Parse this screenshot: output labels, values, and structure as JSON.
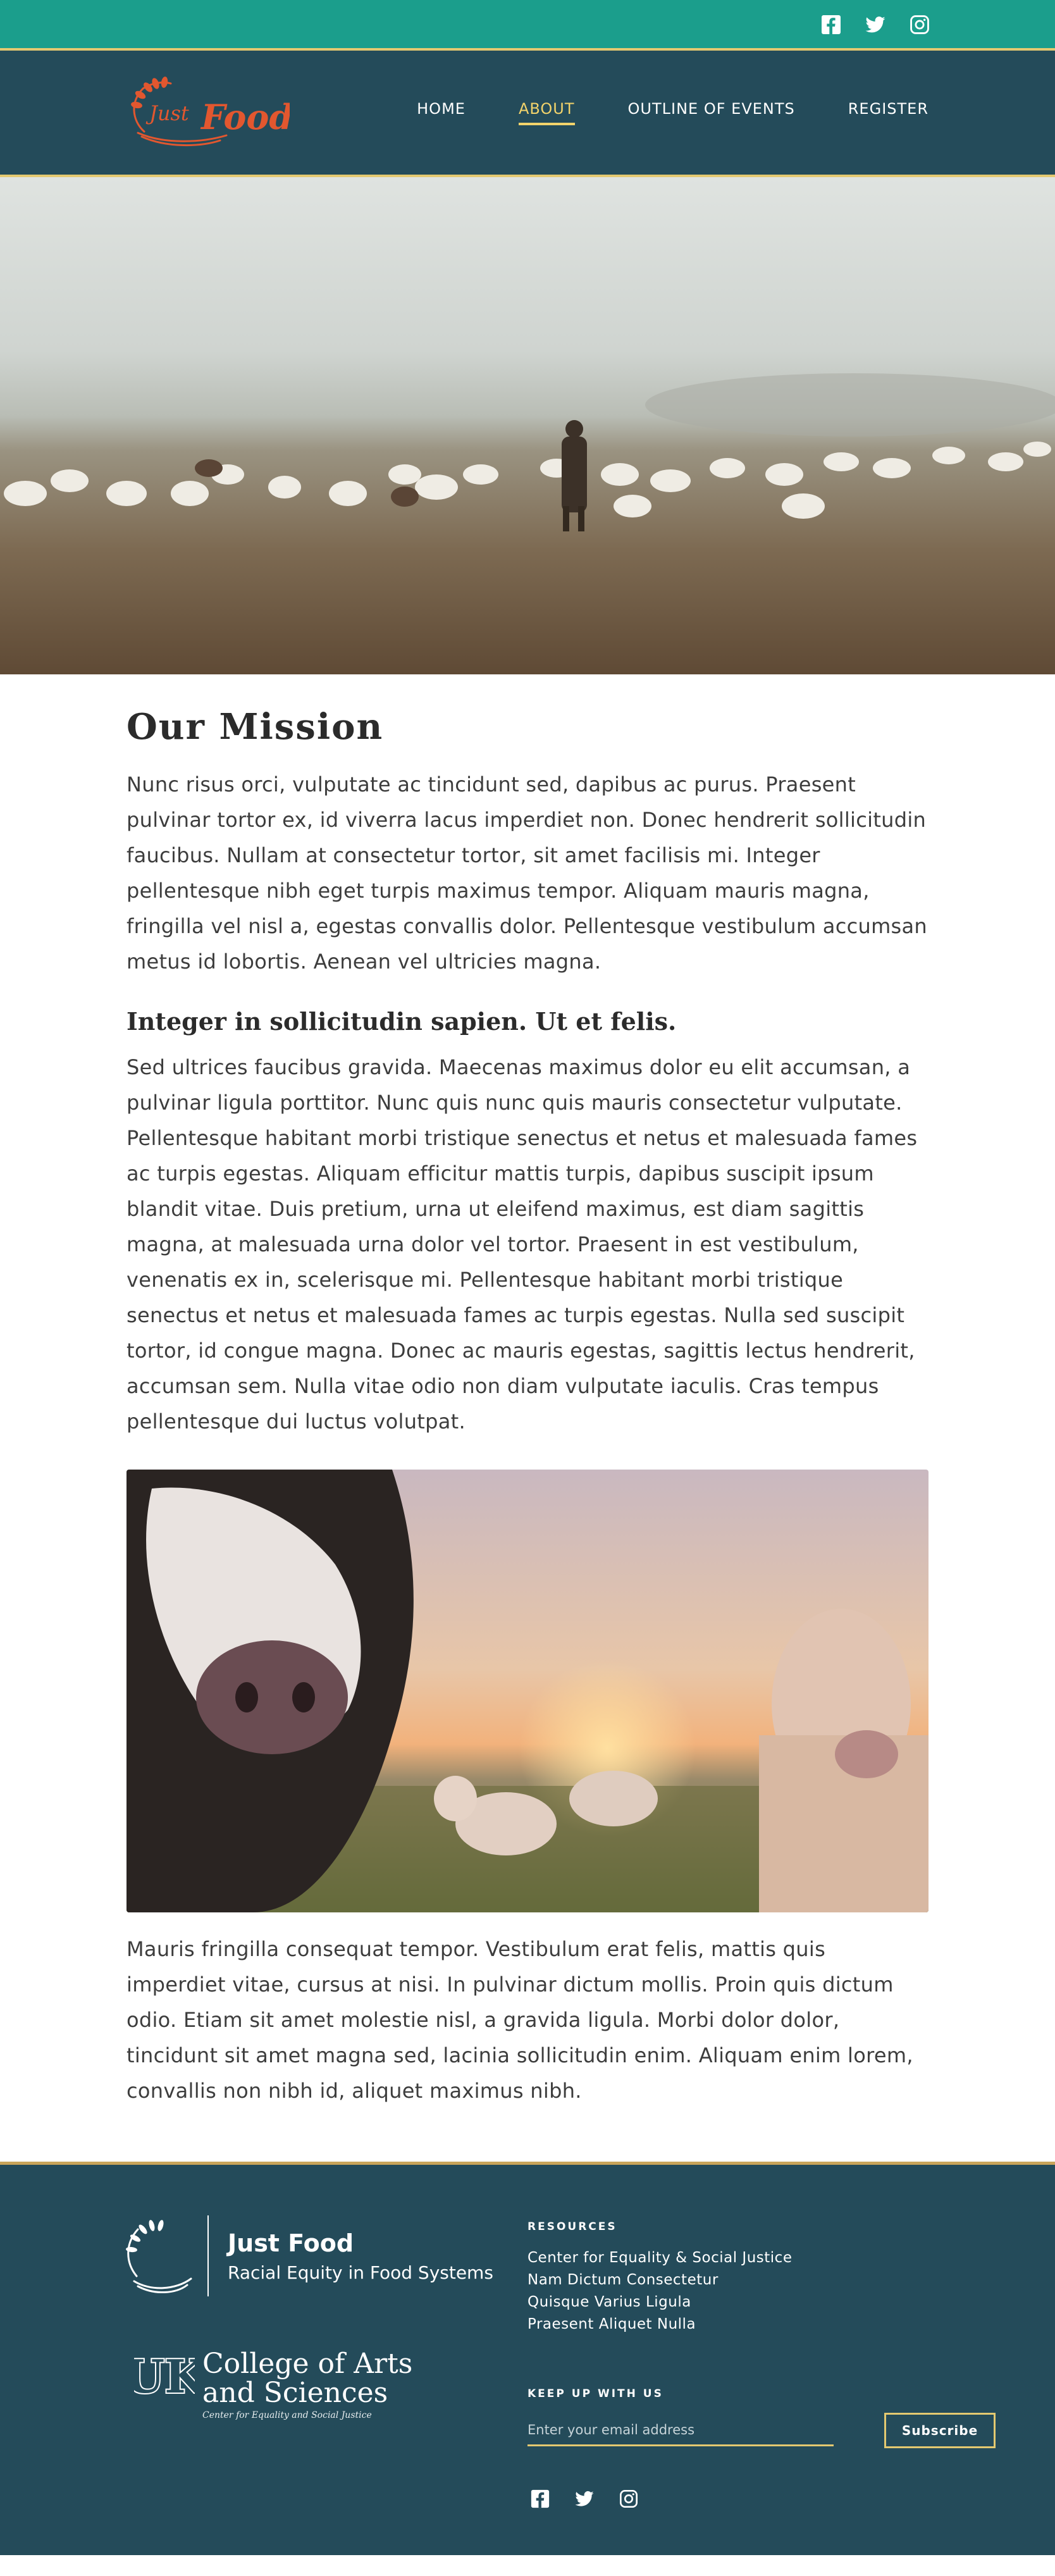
{
  "colors": {
    "topbar": "#1b9e8c",
    "navy": "#244b5a",
    "accent_gold": "#e4c970",
    "active_nav": "#f2d36b",
    "logo_orange": "#e2572f"
  },
  "topbar": {
    "social": [
      "facebook-icon",
      "twitter-icon",
      "instagram-icon"
    ]
  },
  "logo": {
    "text_script": "Just",
    "text_main": "Food"
  },
  "nav": {
    "items": [
      {
        "label": "HOME",
        "active": false
      },
      {
        "label": "ABOUT",
        "active": true
      },
      {
        "label": "OUTLINE OF EVENTS",
        "active": false
      },
      {
        "label": "REGISTER",
        "active": false
      }
    ]
  },
  "main": {
    "title": "Our Mission",
    "para1": "Nunc risus orci, vulputate ac tincidunt sed, dapibus ac purus. Praesent pulvinar tortor ex, id viverra lacus imperdiet non. Donec hendrerit sollicitudin faucibus. Nullam at consectetur tortor, sit amet facilisis mi. Integer pellentesque nibh eget turpis maximus tempor. Aliquam mauris magna, fringilla vel nisl a, egestas convallis dolor. Pellentesque vestibulum accumsan metus id lobortis. Aenean vel ultricies magna.",
    "subtitle": "Integer in sollicitudin sapien. Ut et felis.",
    "para2": "Sed ultrices faucibus gravida. Maecenas maximus dolor eu elit accumsan, a pulvinar ligula porttitor. Nunc quis nunc quis mauris consectetur vulputate. Pellentesque habitant morbi tristique senectus et netus et malesuada fames ac turpis egestas. Aliquam efficitur mattis turpis, dapibus suscipit ipsum blandit vitae. Duis pretium, urna ut eleifend maximus, est diam sagittis magna, at malesuada urna dolor vel tortor. Praesent in est vestibulum, venenatis ex in, scelerisque mi. Pellentesque habitant morbi tristique senectus et netus et malesuada fames ac turpis egestas. Nulla sed suscipit tortor, id congue magna. Donec ac mauris egestas, sagittis lectus hendrerit, accumsan sem. Nulla vitae odio non diam vulputate iaculis. Cras tempus pellentesque dui luctus volutpat.",
    "para3": "Mauris fringilla consequat tempor. Vestibulum erat felis, mattis quis imperdiet vitae, cursus at nisi. In pulvinar dictum mollis. Proin quis dictum odio. Etiam sit amet molestie nisl, a gravida ligula. Morbi dolor dolor, tincidunt sit amet magna sed, lacinia sollicitudin enim. Aliquam enim lorem, convallis non nibh id, aliquet maximus nibh."
  },
  "footer": {
    "brand_title": "Just Food",
    "brand_sub": "Racial Equity in Food Systems",
    "uk": {
      "mark": "UK",
      "line1": "College of Arts",
      "line2": "and Sciences",
      "tagline": "Center for Equality and Social Justice"
    },
    "resources_label": "RESOURCES",
    "resources": [
      "Center for Equality & Social Justice",
      "Nam Dictum Consectetur",
      "Quisque Varius Ligula",
      "Praesent Aliquet Nulla"
    ],
    "newsletter_label": "KEEP UP WITH US",
    "email_placeholder": "Enter your email address",
    "subscribe_label": "Subscribe",
    "social": [
      "facebook-icon",
      "twitter-icon",
      "instagram-icon"
    ]
  }
}
